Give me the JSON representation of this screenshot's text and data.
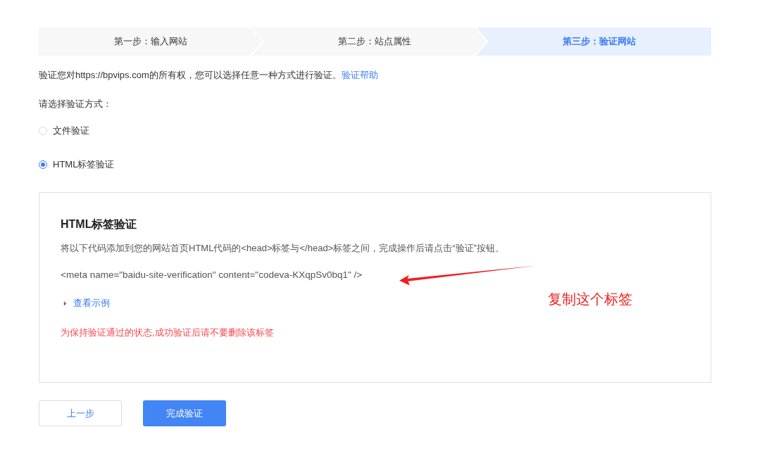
{
  "steps": [
    {
      "label": "第一步：输入网站",
      "selected": false
    },
    {
      "label": "第二步：站点属性",
      "selected": false
    },
    {
      "label": "第三步：验证网站",
      "selected": true
    }
  ],
  "intro": {
    "text": "验证您对https://bpvips.com的所有权，您可以选择任意一种方式进行验证。",
    "link": "验证帮助"
  },
  "method_prompt": "请选择验证方式：",
  "methods": [
    {
      "label": "文件验证",
      "selected": false
    },
    {
      "label": "HTML标签验证",
      "selected": true
    }
  ],
  "panel": {
    "title": "HTML标签验证",
    "instruction": "将以下代码添加到您的网站首页HTML代码的<head>标签与</head>标签之间，完成操作后请点击“验证”按钮。",
    "code": "<meta name=\"baidu-site-verification\" content=\"codeva-KXqpSv0bq1\" />",
    "example_link": "查看示例",
    "expanded": false,
    "warning": "为保持验证通过的状态,成功验证后请不要删除该标签"
  },
  "annotation": "复制这个标签",
  "buttons": [
    {
      "label": "上一步",
      "kind": "secondary"
    },
    {
      "label": "完成验证",
      "kind": "primary"
    }
  ]
}
